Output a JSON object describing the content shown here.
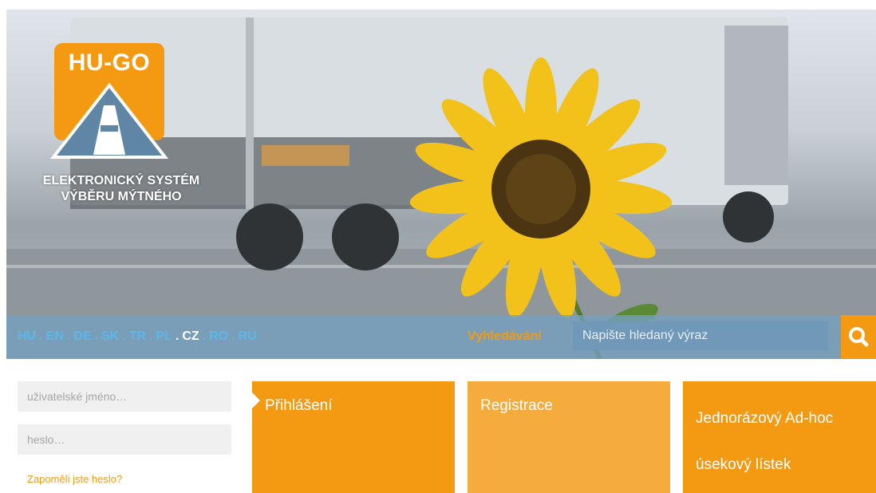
{
  "logo": {
    "title": "HU-GO",
    "subtitle_line1": "ELEKTRONICKÝ SYSTÉM",
    "subtitle_line2": "VÝBĚRU MÝTNÉHO"
  },
  "languages": {
    "items": [
      "HU",
      "EN",
      "DE",
      "SK",
      "TR",
      "PL",
      "CZ",
      "RO",
      "RU"
    ],
    "separator": ".",
    "active": "CZ"
  },
  "search": {
    "label": "Vyhledávání",
    "placeholder": "Napište hledaný výraz",
    "button_icon": "search-icon"
  },
  "login": {
    "username_placeholder": "uživatelské jméno…",
    "password_placeholder": "heslo…",
    "forgot_link": "Zapoměli jste heslo?"
  },
  "tiles": {
    "login": "Přihlášení",
    "register": "Registrace",
    "adhoc_line1": "Jednorázový Ad-hoc",
    "adhoc_line2": "úsekový lístek"
  },
  "colors": {
    "accent": "#f49a12",
    "accent_light": "#f6ab3d",
    "lang_inactive": "#5bb7ea",
    "bar": "#76a0c0"
  }
}
